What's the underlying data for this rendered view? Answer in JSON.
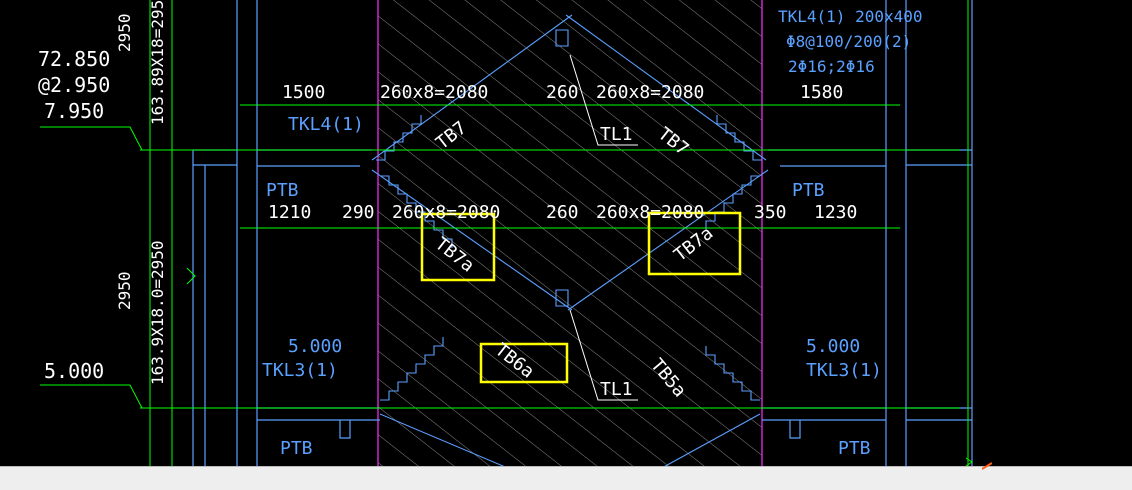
{
  "colors": {
    "background": "#000000",
    "dimension_green": "#00ff00",
    "structure_cyan": "#5aa0ff",
    "text_white": "#ffffff",
    "axis_magenta": "#ff30ff",
    "highlight_yellow": "#ffff00",
    "hatch_gray": "#a8a8a8"
  },
  "elevations": {
    "upper": {
      "line1": "72.850",
      "line2": "@2.950",
      "line3": "7.950"
    },
    "lower": "5.000"
  },
  "vertical_dims": {
    "upper_height": "2950",
    "upper_steps": "163.89X18=2950",
    "lower_height": "2950",
    "lower_steps": "163.9X18.0=2950"
  },
  "top_beam_note": {
    "line1": "TKL4(1) 200x400",
    "line2": "Φ8@100/200(2)",
    "line3": "2Φ16;2Φ16"
  },
  "upper_dims": {
    "left": "1500",
    "run_left": "260x8=2080",
    "mid": "260",
    "run_right": "260x8=2080",
    "right": "1580"
  },
  "lower_dims": {
    "left": "1210",
    "gap_left": "290",
    "run_left": "260x8=2080",
    "mid": "260",
    "run_right": "260x8=2080",
    "gap_right": "350",
    "right": "1230"
  },
  "labels": {
    "tkl4": "TKL4(1)",
    "tb7_left": "TB7",
    "tb7_right": "TB7",
    "tl1_upper": "TL1",
    "tl1_lower": "TL1",
    "ptb_upper_left": "PTB",
    "ptb_upper_right": "PTB",
    "ptb_bottom_left": "PTB",
    "ptb_bottom_right": "PTB",
    "tb7a_left": "TB7a",
    "tb7a_right": "TB7a",
    "tb6a": "TB6a",
    "tb5a": "TB5a",
    "slab_elev_left": "5.000",
    "tkl3_left": "TKL3(1)",
    "slab_elev_right": "5.000",
    "tkl3_right": "TKL3(1)"
  }
}
